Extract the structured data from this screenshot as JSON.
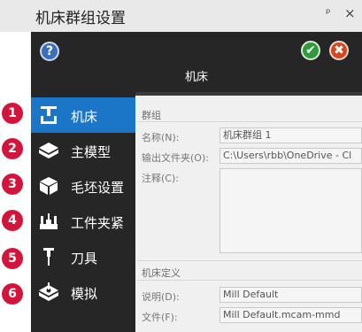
{
  "window": {
    "title": "机床群组设置",
    "pin_glyph": "ᵖ",
    "close_glyph": "×"
  },
  "header": {
    "help_glyph": "?",
    "ok_glyph": "✔",
    "cancel_glyph": "✖",
    "title": "机床"
  },
  "nav": {
    "items": [
      {
        "label": "机床",
        "badge": "1",
        "icon": "machine-icon",
        "selected": true
      },
      {
        "label": "主模型",
        "badge": "2",
        "icon": "main-model-icon"
      },
      {
        "label": "毛坯设置",
        "badge": "3",
        "icon": "stock-setup-icon"
      },
      {
        "label": "工件夹紧",
        "badge": "4",
        "icon": "fixture-icon"
      },
      {
        "label": "刀具",
        "badge": "5",
        "icon": "tool-icon"
      },
      {
        "label": "模拟",
        "badge": "6",
        "icon": "simulation-icon"
      }
    ]
  },
  "group": {
    "section_title": "群组",
    "name_label": "名称(N):",
    "name_value": "机床群组 1",
    "output_label": "输出文件夹(O):",
    "output_value": "C:\\Users\\rbb\\OneDrive - Cl",
    "notes_label": "注释(C):",
    "notes_value": ""
  },
  "machine_def": {
    "section_title": "机床定义",
    "desc_label": "说明(D):",
    "desc_value": "Mill Default",
    "file_label": "文件(F):",
    "file_value": "Mill Default.mcam-mmd"
  },
  "colors": {
    "selected_bg": "#1c76c8",
    "dark_bg": "#262626",
    "badge_red": "#d3143b",
    "ok_green": "#2f9a3a",
    "cancel_orange": "#d3481f",
    "help_blue": "#3a70b8"
  }
}
